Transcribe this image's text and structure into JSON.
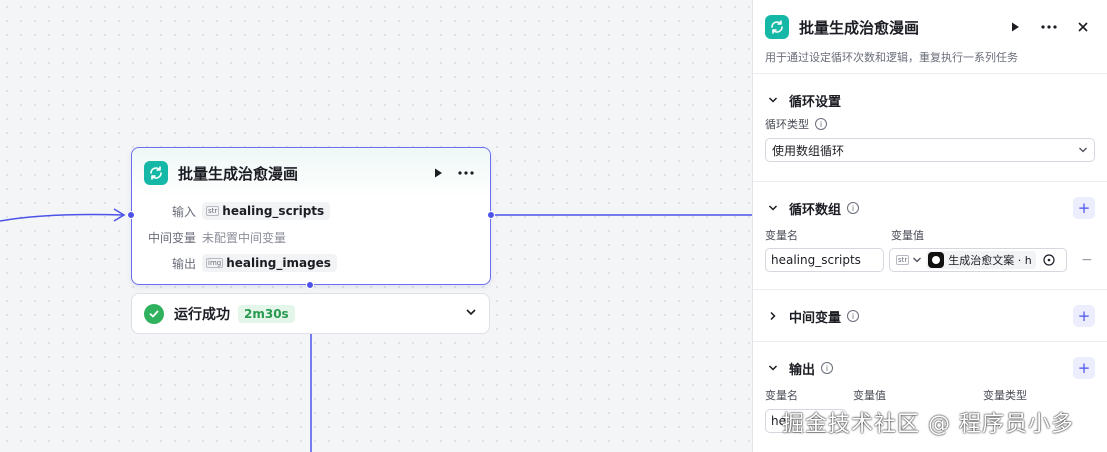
{
  "node": {
    "title": "批量生成治愈漫画",
    "input_label": "输入",
    "input_type": "str",
    "input_value": "healing_scripts",
    "midvar_label": "中间变量",
    "midvar_value": "未配置中间变量",
    "output_label": "输出",
    "output_type": "img",
    "output_value": "healing_images"
  },
  "result": {
    "status": "运行成功",
    "duration": "2m30s"
  },
  "panel": {
    "title": "批量生成治愈漫画",
    "description": "用于通过设定循环次数和逻辑，重复执行一系列任务",
    "loop_settings": {
      "title": "循环设置",
      "type_label": "循环类型",
      "type_value": "使用数组循环"
    },
    "loop_array": {
      "title": "循环数组",
      "col_name": "变量名",
      "col_value": "变量值",
      "var_name": "healing_scripts",
      "var_type": "str",
      "ref_value": "生成治愈文案 · h"
    },
    "mid_vars": {
      "title": "中间变量"
    },
    "output": {
      "title": "输出",
      "col_name": "变量名",
      "col_value": "变量值",
      "col_type": "变量类型",
      "var_name_partial": "he"
    }
  },
  "watermark": "掘金技术社区 @ 程序员小多",
  "colors": {
    "accent": "#4d53e8",
    "loop_badge": "#15b8a6",
    "success": "#2fb15d"
  }
}
